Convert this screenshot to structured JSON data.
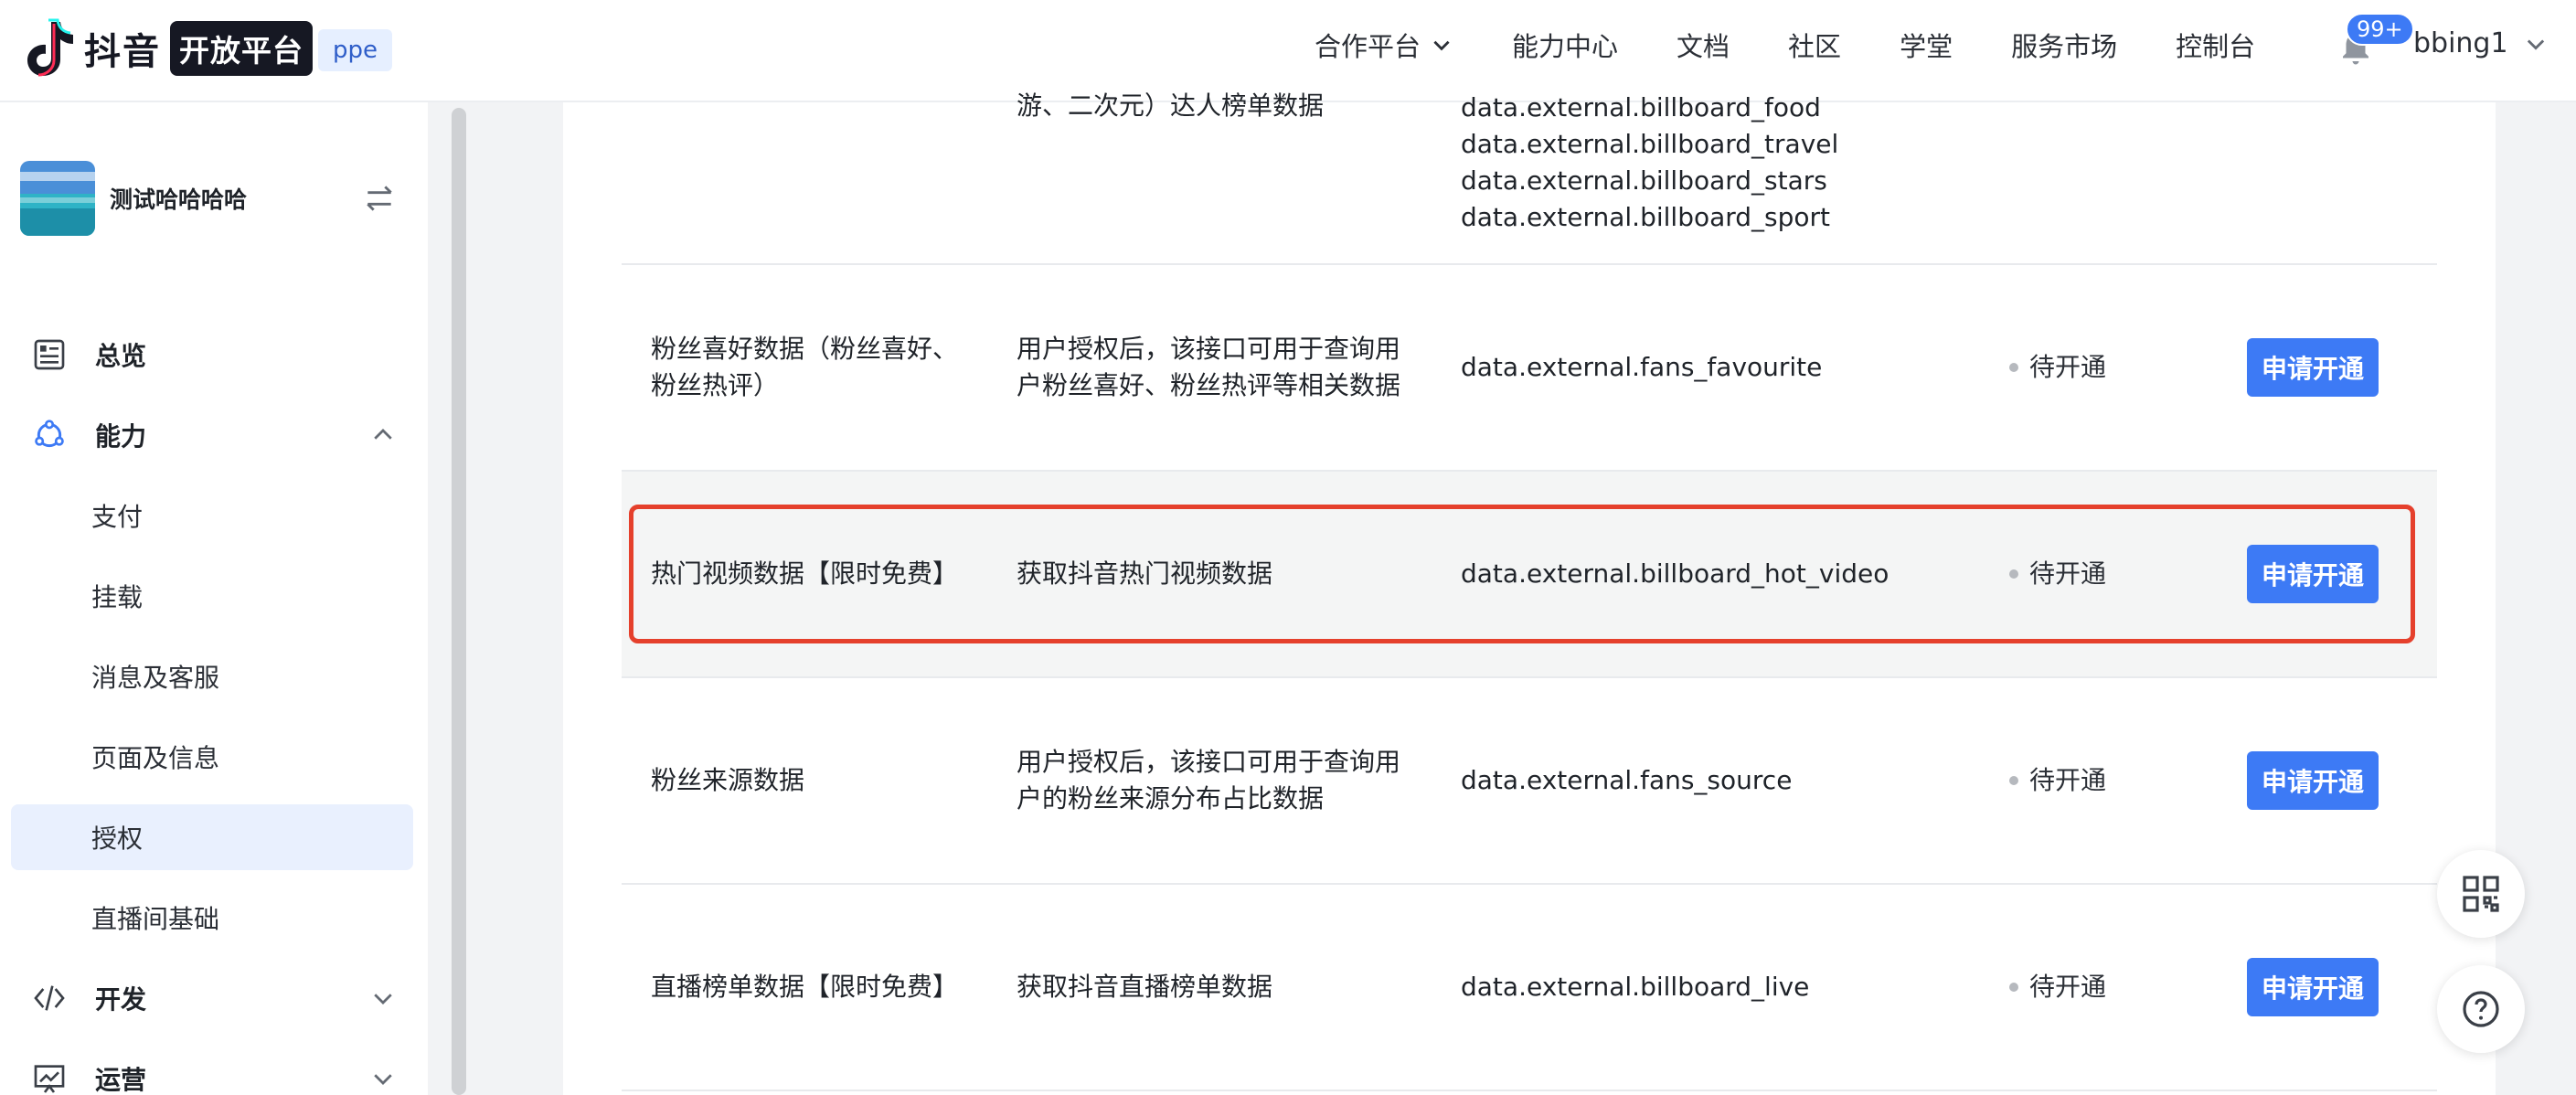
{
  "header": {
    "logo_text": "抖音",
    "logo_box": "开放平台",
    "env_badge": "ppe",
    "nav": [
      "合作平台",
      "能力中心",
      "文档",
      "社区",
      "学堂",
      "服务市场",
      "控制台"
    ],
    "notification_badge": "99+",
    "username": "bbing1"
  },
  "sidebar": {
    "app_name": "测试哈哈哈哈",
    "menu": {
      "overview": "总览",
      "capability": "能力",
      "capability_items": [
        "支付",
        "挂载",
        "消息及客服",
        "页面及信息",
        "授权",
        "直播间基础"
      ],
      "develop": "开发",
      "operate": "运营"
    },
    "active_item": "授权"
  },
  "table": {
    "partial_row": {
      "desc_tail": "游、二次元）达人榜单数据",
      "scopes": [
        "data.external.billboard_food",
        "data.external.billboard_travel",
        "data.external.billboard_stars",
        "data.external.billboard_sport"
      ]
    },
    "rows": [
      {
        "name_line1": "粉丝喜好数据（粉丝喜好、",
        "name_line2": "粉丝热评）",
        "desc_line1": "用户授权后，该接口可用于查询用",
        "desc_line2": "户粉丝喜好、粉丝热评等相关数据",
        "scope": "data.external.fans_favourite",
        "status": "待开通",
        "action": "申请开通"
      },
      {
        "name_line1": "热门视频数据【限时免费】",
        "name_line2": "",
        "desc_line1": "获取抖音热门视频数据",
        "desc_line2": "",
        "scope": "data.external.billboard_hot_video",
        "status": "待开通",
        "action": "申请开通"
      },
      {
        "name_line1": "粉丝来源数据",
        "name_line2": "",
        "desc_line1": "用户授权后，该接口可用于查询用",
        "desc_line2": "户的粉丝来源分布占比数据",
        "scope": "data.external.fans_source",
        "status": "待开通",
        "action": "申请开通"
      },
      {
        "name_line1": "直播榜单数据【限时免费】",
        "name_line2": "",
        "desc_line1": "获取抖音直播榜单数据",
        "desc_line2": "",
        "scope": "data.external.billboard_live",
        "status": "待开通",
        "action": "申请开通"
      }
    ]
  },
  "colors": {
    "accent": "#3d7af5",
    "highlight_border": "#e5402c",
    "active_menu_bg": "#e9f0fe"
  },
  "icons": {
    "logo": "douyin-note-icon",
    "nav_dropdown": "chevron-down-icon",
    "bell": "bell-icon",
    "switch": "switch-arrows-icon",
    "overview": "dashboard-icon",
    "capability": "capability-icon",
    "develop": "code-icon",
    "operate": "chart-icon",
    "qr": "qr-code-icon",
    "help": "help-icon"
  }
}
